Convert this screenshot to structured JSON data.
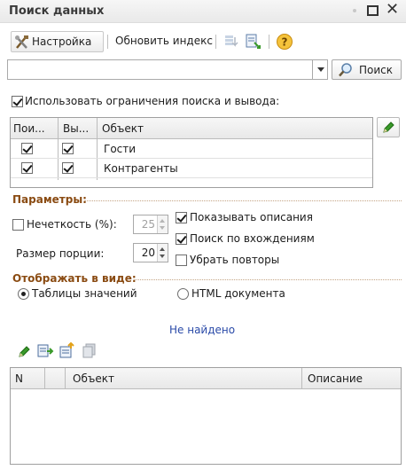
{
  "window": {
    "title": "Поиск данных"
  },
  "toolbar": {
    "settings_label": "Настройка",
    "update_index_label": "Обновить индекс"
  },
  "search": {
    "value": "",
    "placeholder": "",
    "button_label": "Поиск"
  },
  "restrictions": {
    "use_label": "Использовать ограничения поиска и вывода:",
    "use_checked": true,
    "columns": [
      "Пои...",
      "Вы...",
      "Объект"
    ],
    "rows": [
      {
        "search": true,
        "output": true,
        "object": "Гости"
      },
      {
        "search": true,
        "output": true,
        "object": "Контрагенты"
      }
    ]
  },
  "params": {
    "title": "Параметры:",
    "fuzzy_label": "Нечеткость (%):",
    "fuzzy_checked": false,
    "fuzzy_value": "25",
    "portion_label": "Размер порции:",
    "portion_value": "20",
    "show_desc_label": "Показывать описания",
    "show_desc_checked": true,
    "search_occ_label": "Поиск по вхождениям",
    "search_occ_checked": true,
    "remove_dup_label": "Убрать повторы",
    "remove_dup_checked": false
  },
  "display": {
    "title": "Отображать в виде:",
    "option_table": "Таблицы значений",
    "option_html": "HTML документа",
    "selected": "Таблицы значений"
  },
  "status": "Не найдено",
  "results": {
    "columns": [
      "N",
      "Объект",
      "Описание"
    ]
  },
  "colors": {
    "section": "#8a4b12",
    "status": "#2a4aa8"
  }
}
